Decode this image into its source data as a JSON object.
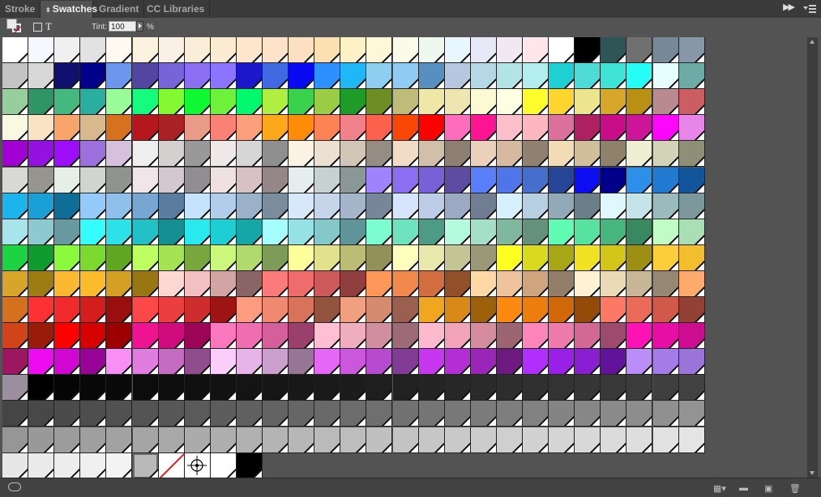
{
  "tabs": [
    {
      "label": "Stroke",
      "active": false
    },
    {
      "label": "Swatches",
      "active": true
    },
    {
      "label": "Gradient",
      "active": false
    },
    {
      "label": "CC Libraries",
      "active": false
    }
  ],
  "tint": {
    "label": "Tint:",
    "value": "100",
    "unit": "%"
  },
  "swatches": [
    [
      "#ffffff",
      "#f7f7ff",
      "#f0f0f0",
      "#e2e2e2",
      "#fff9ef",
      "#fdf2e0",
      "#fbf0e6",
      "#fbeed8",
      "#fbecd1",
      "#fde6cc",
      "#fde3c9",
      "#fde0c2",
      "#fde0b2",
      "#fef1c7",
      "#fdf8d8",
      "#fbfbe9",
      "#eef8ee",
      "#e8f6fd",
      "#e6e8f7",
      "#f2e8f4",
      "#ffe6ea",
      "#ffffff",
      "#000000",
      "#2f5656",
      "#707070",
      "#778899",
      "#8797a7"
    ],
    [
      "#c4c4c4",
      "#d7d7d7",
      "#10106e",
      "#00008b",
      "#6c96ee",
      "#5346a0",
      "#7765d7",
      "#8b6ff2",
      "#8b74ff",
      "#1b18cc",
      "#4169e1",
      "#0a0af2",
      "#2e8fff",
      "#1fb7f5",
      "#8ecff0",
      "#8eccf3",
      "#578fc0",
      "#b6c7e0",
      "#b4d8e6",
      "#b2e3e5",
      "#b3eded",
      "#1ecfd4",
      "#4edbd5",
      "#3de4d5",
      "#25fdf6",
      "#e6fefe",
      "#6eaba6"
    ],
    [
      "#97cf9c",
      "#2f9565",
      "#45b87f",
      "#2aae9e",
      "#98fc97",
      "#15fb80",
      "#84f932",
      "#0ef931",
      "#6df13a",
      "#03f96d",
      "#b0ee41",
      "#3ad14d",
      "#9bcc45",
      "#1f9b2a",
      "#6e8d23",
      "#bebc78",
      "#eee7a6",
      "#ede6b3",
      "#fcfad3",
      "#fefee2",
      "#fefe2c",
      "#fdd52e",
      "#ede58d",
      "#d8a72a",
      "#b98f14",
      "#b98a90",
      "#cc5e63"
    ],
    [
      "#f9f8e2",
      "#f9e3c2",
      "#f7a56a",
      "#d7b98d",
      "#d5711f",
      "#b4171d",
      "#aa2126",
      "#e89c87",
      "#f98175",
      "#fba07b",
      "#fda71a",
      "#fd8c09",
      "#fd8356",
      "#f0818a",
      "#fc614d",
      "#f84605",
      "#ff0000",
      "#fe6dbb",
      "#ff1493",
      "#fdbfcb",
      "#fdb7c1",
      "#da709b",
      "#ae2060",
      "#c80d88",
      "#ce159a",
      "#fc07f7",
      "#e885e8"
    ],
    [
      "#a101d2",
      "#9412df",
      "#9d0ff9",
      "#9c70dd",
      "#d6c1dc",
      "#efeeee",
      "#d4d0d0",
      "#999999",
      "#eee8e8",
      "#d6d6d6",
      "#8f8f8f",
      "#fdf3e4",
      "#ece0d4",
      "#d1c5b7",
      "#958c84",
      "#f1ddc6",
      "#d2bfaa",
      "#8d7f72",
      "#ebd0bb",
      "#d5b9a0",
      "#908170",
      "#f1dcb5",
      "#d1be9b",
      "#8e826a",
      "#efefd3",
      "#d3d3b8",
      "#8f8f78"
    ],
    [
      "#d9d9d3",
      "#96968f",
      "#e6efe6",
      "#cfd6cf",
      "#8f948f",
      "#f0e6ea",
      "#d2c8ce",
      "#918d90",
      "#efe0e2",
      "#d6c1c4",
      "#958688",
      "#e5eded",
      "#c8d1d2",
      "#8b9697",
      "#9e84fc",
      "#8b6ff2",
      "#7860d8",
      "#5d4ca2",
      "#5a7ef9",
      "#5074e9",
      "#466fcd",
      "#264597",
      "#0e0ef2",
      "#00008b",
      "#2c8fe9",
      "#2279d0",
      "#13559a"
    ],
    [
      "#1bb4ed",
      "#1a9fd6",
      "#0e6e98",
      "#94cbfc",
      "#8fc0ec",
      "#78a6d3",
      "#5a7d9f",
      "#c6e3fd",
      "#b1cdea",
      "#9ab1c8",
      "#7b8d9d",
      "#d8e8fb",
      "#c6d5e9",
      "#a6b6ca",
      "#78869a",
      "#d6e5fd",
      "#bdcce7",
      "#9baac2",
      "#707d92",
      "#d7f0fe",
      "#b6d0e2",
      "#92aab8",
      "#6b7f89",
      "#def8fe",
      "#c4e4ea",
      "#9bbabe",
      "#7d989d"
    ],
    [
      "#a7e5ec",
      "#8dc9d1",
      "#669aa0",
      "#34fdfd",
      "#2ce1e8",
      "#22c1c7",
      "#168f93",
      "#28e9ec",
      "#1dcfd4",
      "#15a6a8",
      "#a6fdfd",
      "#95e2e4",
      "#84c8ca",
      "#5f9599",
      "#7cfdd1",
      "#6fe3c0",
      "#4e9b85",
      "#b3fbdc",
      "#a4dfc7",
      "#80b79f",
      "#63917c",
      "#61fcb3",
      "#57e2a0",
      "#48b47e",
      "#38895f",
      "#bffdc4",
      "#aadeb4"
    ],
    [
      "#1cd341",
      "#0f9b2d",
      "#8cfa3c",
      "#7cd92e",
      "#5fa621",
      "#bfff62",
      "#a5e352",
      "#79a73d",
      "#caf77c",
      "#b0d96e",
      "#7e9c58",
      "#fdfd9c",
      "#e2e28d",
      "#bcbc74",
      "#919159",
      "#fefdbc",
      "#e8e7ac",
      "#c4c494",
      "#999977",
      "#fefe20",
      "#d9d91f",
      "#a6a617",
      "#f0e122",
      "#d3c619",
      "#9c8f13",
      "#fbcd38",
      "#f3be2d"
    ],
    [
      "#d8a52b",
      "#9d7d13",
      "#fdb832",
      "#fbbc2b",
      "#d3a023",
      "#987611",
      "#fdd8d2",
      "#f3c0c2",
      "#d2a4a4",
      "#8a6566",
      "#fd7a7a",
      "#ee6c6c",
      "#cc5a5a",
      "#913e3e",
      "#fd9858",
      "#f2884c",
      "#d36c3e",
      "#92502a",
      "#fed8a5",
      "#efc39c",
      "#cfa57f",
      "#917d68",
      "#fef2d3",
      "#e9dbb6",
      "#c7b796",
      "#948873",
      "#fcab6d"
    ],
    [
      "#d5701f",
      "#fc3232",
      "#f12b2b",
      "#d41d1d",
      "#9b0e0e",
      "#fc4848",
      "#eb3e3e",
      "#cd2d2d",
      "#9e1313",
      "#fd9c7e",
      "#ef8a70",
      "#d7725b",
      "#92533f",
      "#f0a07e",
      "#d48b6e",
      "#9a5f4e",
      "#f0a71f",
      "#d98a16",
      "#9e610b",
      "#fc8a10",
      "#eb7e0c",
      "#d0680a",
      "#944b08",
      "#fd7966",
      "#ec6b58",
      "#d1594a",
      "#924134"
    ],
    [
      "#d2431a",
      "#991b0a",
      "#fd0000",
      "#d70000",
      "#9d0000",
      "#ed1391",
      "#d00b7c",
      "#9d0556",
      "#fb77be",
      "#ef6eb1",
      "#d55f9b",
      "#99406c",
      "#fdbfd1",
      "#efadc0",
      "#d08f9f",
      "#9d6b77",
      "#fdb9cd",
      "#f0a3b9",
      "#d58c9e",
      "#9d6472",
      "#fc86b9",
      "#ee79ab",
      "#d26993",
      "#9d4b6c",
      "#fd12b5",
      "#e70ea4",
      "#cc0d91"
    ],
    [
      "#9c1660",
      "#ed0bef",
      "#d006d3",
      "#970297",
      "#f98ef6",
      "#e07ee0",
      "#c46bc2",
      "#8f4d8d",
      "#fbcdfb",
      "#e6b4e6",
      "#cca0cc",
      "#957695",
      "#e567f5",
      "#cb58dc",
      "#b84ad0",
      "#833c95",
      "#c936f1",
      "#b32ed5",
      "#9b25b8",
      "#6d1a81",
      "#b02ffc",
      "#9a20e8",
      "#8a1ed1",
      "#61149b",
      "#ba8df8",
      "#a47ce8",
      "#9a74d8"
    ],
    [
      "#9b8e9e",
      "#000000",
      "#050505",
      "#080808",
      "#0a0a0a",
      "#0c0c0c",
      "#0e0e0e",
      "#101010",
      "#121212",
      "#141414",
      "#161616",
      "#181818",
      "#1a1a1a",
      "#1c1c1c",
      "#1e1e1e",
      "#212121",
      "#242424",
      "#272727",
      "#2a2a2a",
      "#2d2d2d",
      "#303030",
      "#333333",
      "#363636",
      "#393939",
      "#3c3c3c",
      "#3f3f3f",
      "#424242"
    ],
    [
      "#454545",
      "#484848",
      "#4b4b4b",
      "#4e4e4e",
      "#515151",
      "#545454",
      "#575757",
      "#5a5a5a",
      "#5d5d5d",
      "#606060",
      "#636363",
      "#666666",
      "#696969",
      "#6c6c6c",
      "#6f6f6f",
      "#727272",
      "#757575",
      "#787878",
      "#7b7b7b",
      "#7e7e7e",
      "#818181",
      "#848484",
      "#878787",
      "#8a8a8a",
      "#8d8d8d",
      "#909090",
      "#939393"
    ],
    [
      "#969696",
      "#999999",
      "#9c9c9c",
      "#9f9f9f",
      "#a2a2a2",
      "#a5a5a5",
      "#a8a8a8",
      "#ababab",
      "#aeaeae",
      "#b1b1b1",
      "#b4b4b4",
      "#b7b7b7",
      "#bababa",
      "#bdbdbd",
      "#c0c0c0",
      "#c3c3c3",
      "#c6c6c6",
      "#c9c9c9",
      "#cccccc",
      "#cfcfcf",
      "#d2d2d2",
      "#d5d5d5",
      "#d8d8d8",
      "#dbdbdb",
      "#dedede",
      "#e1e1e1",
      "#e4e4e4"
    ],
    [
      "#e7e7e7",
      "#eaeaea",
      "#ededed",
      "#f0f0f0",
      "#f3f3f3",
      "#b9b9b9",
      "none",
      "registration",
      "#ffffff",
      "#000000"
    ]
  ]
}
